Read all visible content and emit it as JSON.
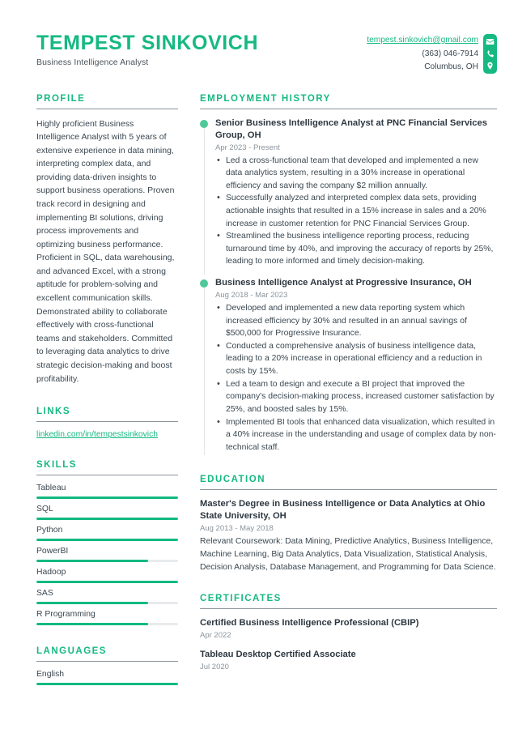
{
  "accent_color": "#16b981",
  "text_color": "#3a4750",
  "muted_color": "#8a949c",
  "header": {
    "full_name": "TEMPEST SINKOVICH",
    "job_title": "Business Intelligence Analyst",
    "contact": {
      "email": "tempest.sinkovich@gmail.com",
      "phone": "(363) 046-7914",
      "location": "Columbus, OH"
    },
    "icons": [
      "envelope-icon",
      "phone-icon",
      "location-pin-icon"
    ]
  },
  "sidebar": {
    "profile": {
      "heading": "PROFILE",
      "text": "Highly proficient Business Intelligence Analyst with 5 years of extensive experience in data mining, interpreting complex data, and providing data-driven insights to support business operations. Proven track record in designing and implementing BI solutions, driving process improvements and optimizing business performance. Proficient in SQL, data warehousing, and advanced Excel, with a strong aptitude for problem-solving and excellent communication skills. Demonstrated ability to collaborate effectively with cross-functional teams and stakeholders. Committed to leveraging data analytics to drive strategic decision-making and boost profitability."
    },
    "links": {
      "heading": "LINKS",
      "items": [
        {
          "label": "linkedin.com/in/tempestsinkovich"
        }
      ]
    },
    "skills": {
      "heading": "SKILLS",
      "items": [
        {
          "name": "Tableau",
          "level": 100
        },
        {
          "name": "SQL",
          "level": 100
        },
        {
          "name": "Python",
          "level": 100
        },
        {
          "name": "PowerBI",
          "level": 79
        },
        {
          "name": "Hadoop",
          "level": 100
        },
        {
          "name": "SAS",
          "level": 79
        },
        {
          "name": "R Programming",
          "level": 79
        }
      ]
    },
    "languages": {
      "heading": "LANGUAGES",
      "items": [
        {
          "name": "English",
          "level": 100
        }
      ]
    }
  },
  "main": {
    "employment": {
      "heading": "EMPLOYMENT HISTORY",
      "entries": [
        {
          "title": "Senior Business Intelligence Analyst at PNC Financial Services Group, OH",
          "date": "Apr 2023 - Present",
          "bullets": [
            "Led a cross-functional team that developed and implemented a new data analytics system, resulting in a 30% increase in operational efficiency and saving the company $2 million annually.",
            "Successfully analyzed and interpreted complex data sets, providing actionable insights that resulted in a 15% increase in sales and a 20% increase in customer retention for PNC Financial Services Group.",
            "Streamlined the business intelligence reporting process, reducing turnaround time by 40%, and improving the accuracy of reports by 25%, leading to more informed and timely decision-making."
          ]
        },
        {
          "title": "Business Intelligence Analyst at Progressive Insurance, OH",
          "date": "Aug 2018 - Mar 2023",
          "bullets": [
            "Developed and implemented a new data reporting system which increased efficiency by 30% and resulted in an annual savings of $500,000 for Progressive Insurance.",
            "Conducted a comprehensive analysis of business intelligence data, leading to a 20% increase in operational efficiency and a reduction in costs by 15%.",
            "Led a team to design and execute a BI project that improved the company's decision-making process, increased customer satisfaction by 25%, and boosted sales by 15%.",
            "Implemented BI tools that enhanced data visualization, which resulted in a 40% increase in the understanding and usage of complex data by non-technical staff."
          ]
        }
      ]
    },
    "education": {
      "heading": "EDUCATION",
      "entries": [
        {
          "title": "Master's Degree in Business Intelligence or Data Analytics at Ohio State University, OH",
          "date": "Aug 2013 - May 2018",
          "description": "Relevant Coursework: Data Mining, Predictive Analytics, Business Intelligence, Machine Learning, Big Data Analytics, Data Visualization, Statistical Analysis, Decision Analysis, Database Management, and Programming for Data Science."
        }
      ]
    },
    "certificates": {
      "heading": "CERTIFICATES",
      "entries": [
        {
          "title": "Certified Business Intelligence Professional (CBIP)",
          "date": "Apr 2022"
        },
        {
          "title": "Tableau Desktop Certified Associate",
          "date": "Jul 2020"
        }
      ]
    }
  }
}
